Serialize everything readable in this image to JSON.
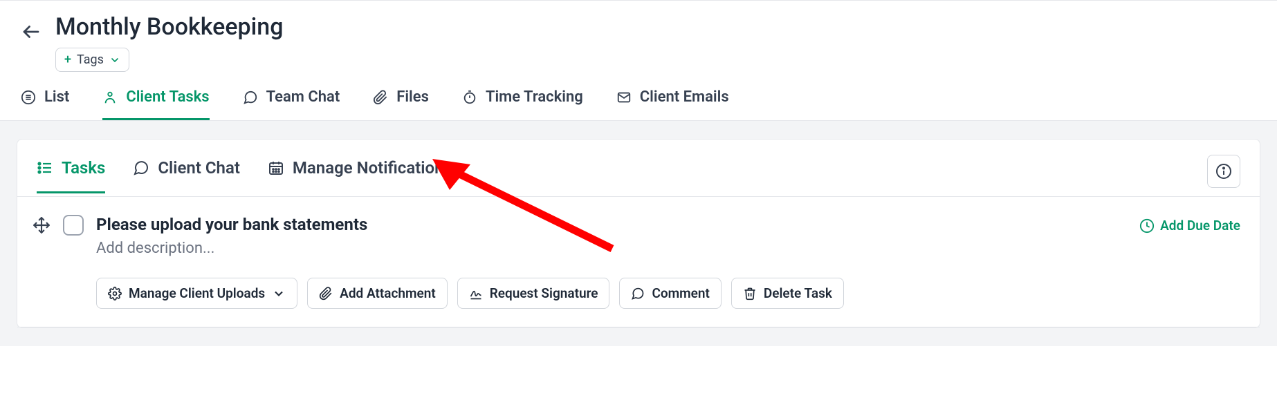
{
  "header": {
    "title": "Monthly Bookkeeping",
    "tags_label": "Tags"
  },
  "main_tabs": {
    "list": "List",
    "client_tasks": "Client Tasks",
    "team_chat": "Team Chat",
    "files": "Files",
    "time_tracking": "Time Tracking",
    "client_emails": "Client Emails",
    "active": "client_tasks"
  },
  "sub_tabs": {
    "tasks": "Tasks",
    "client_chat": "Client Chat",
    "manage_notifications": "Manage Notifications",
    "active": "tasks"
  },
  "task": {
    "title": "Please upload your bank statements",
    "description_placeholder": "Add description...",
    "due_date_label": "Add Due Date"
  },
  "actions": {
    "manage_client_uploads": "Manage Client Uploads",
    "add_attachment": "Add Attachment",
    "request_signature": "Request Signature",
    "comment": "Comment",
    "delete_task": "Delete Task"
  }
}
